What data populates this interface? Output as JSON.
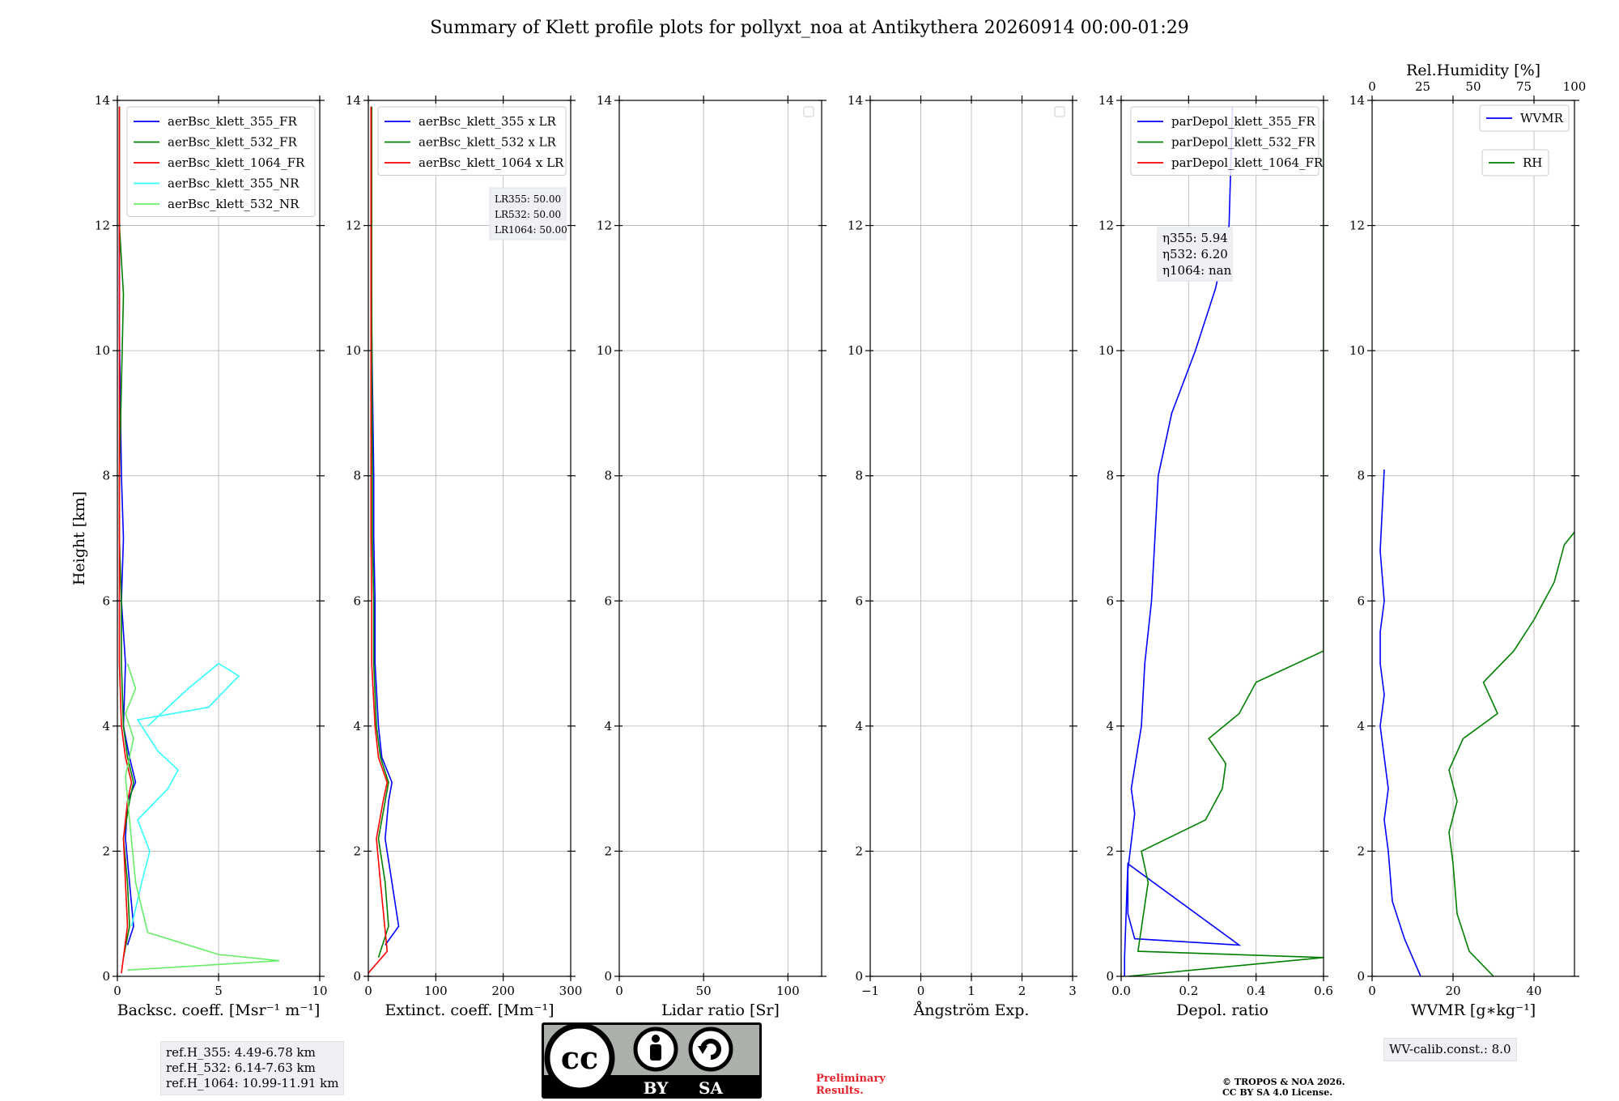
{
  "title": "Summary of Klett profile plots for pollyxt_noa at Antikythera 20260914 00:00-01:29",
  "ylabel": "Height [km]",
  "colors": {
    "blue": "#0000ff",
    "green": "#008000",
    "red": "#ff0000",
    "cyan": "#33ffff",
    "lightgreen": "#66ee66",
    "grid": "#b0b0b0"
  },
  "panels": [
    {
      "id": "bsc",
      "xlabel": "Backsc. coeff. [Msr⁻¹ m⁻¹]",
      "xlim": [
        0,
        10
      ],
      "xticks": [
        "0",
        "5",
        "10"
      ],
      "legend": [
        "aerBsc_klett_355_FR",
        "aerBsc_klett_532_FR",
        "aerBsc_klett_1064_FR",
        "aerBsc_klett_355_NR",
        "aerBsc_klett_532_NR"
      ]
    },
    {
      "id": "ext",
      "xlabel": "Extinct. coeff. [Mm⁻¹]",
      "xlim": [
        0,
        300
      ],
      "xticks": [
        "0",
        "100",
        "200",
        "300"
      ],
      "legend": [
        "aerBsc_klett_355 x LR",
        "aerBsc_klett_532 x LR",
        "aerBsc_klett_1064 x LR"
      ],
      "lr_box": [
        "LR355: 50.00",
        "LR532: 50.00",
        "LR1064: 50.00"
      ]
    },
    {
      "id": "lr",
      "xlabel": "Lidar ratio [Sr]",
      "xlim": [
        0,
        120
      ],
      "xticks": [
        "0",
        "50",
        "100"
      ]
    },
    {
      "id": "ang",
      "xlabel": "Ångström Exp.",
      "xlim": [
        -1,
        3
      ],
      "xticks": [
        "−1",
        "0",
        "1",
        "2",
        "3"
      ]
    },
    {
      "id": "dep",
      "xlabel": "Depol. ratio",
      "xlim": [
        0,
        0.6
      ],
      "xticks": [
        "0.0",
        "0.2",
        "0.4",
        "0.6"
      ],
      "legend": [
        "parDepol_klett_355_FR",
        "parDepol_klett_532_FR",
        "parDepol_klett_1064_FR"
      ],
      "eta_box": [
        "η355: 5.94",
        "η532: 6.20",
        "η1064: nan"
      ]
    },
    {
      "id": "wv",
      "xlabel": "WVMR [g∗kg⁻¹]",
      "xlim": [
        0,
        50
      ],
      "xticks": [
        "0",
        "20",
        "40"
      ],
      "top_label": "Rel.Humidity [%]",
      "top_ticks": [
        "0",
        "25",
        "50",
        "75",
        "100"
      ],
      "legend_wvmr": "WVMR",
      "legend_rh": "RH"
    }
  ],
  "yticks": [
    "0",
    "2",
    "4",
    "6",
    "8",
    "10",
    "12",
    "14"
  ],
  "chart_data": {
    "type": "line",
    "ylim": [
      0,
      14
    ],
    "grid": true,
    "series": [
      {
        "name": "aerBsc_klett_355_FR",
        "panel": "bsc",
        "x": [
          0.5,
          0.8,
          0.6,
          0.4,
          0.5,
          0.9,
          0.6,
          0.3,
          0.4,
          0.2,
          0.3,
          0.2,
          0.1,
          0.1,
          0.1
        ],
        "y": [
          0.5,
          0.8,
          1.5,
          2.2,
          2.8,
          3.1,
          3.5,
          4.0,
          5.0,
          6.0,
          7.0,
          8.0,
          10.3,
          12.0,
          13.9
        ]
      },
      {
        "name": "aerBsc_klett_532_FR",
        "panel": "bsc",
        "x": [
          0.3,
          0.6,
          0.5,
          0.3,
          0.6,
          0.8,
          0.5,
          0.3,
          0.2,
          0.2,
          0.1,
          0.1,
          0.3,
          0.1,
          0.1
        ],
        "y": [
          0.3,
          0.8,
          1.5,
          2.2,
          2.8,
          3.1,
          3.5,
          4.0,
          5.0,
          6.0,
          7.0,
          8.0,
          10.9,
          12.0,
          13.9
        ]
      },
      {
        "name": "aerBsc_klett_1064_FR",
        "panel": "bsc",
        "x": [
          0.2,
          0.5,
          0.4,
          0.3,
          0.5,
          0.7,
          0.4,
          0.2,
          0.1,
          0.1,
          0.1,
          0.1,
          0.1,
          0.1,
          0.1
        ],
        "y": [
          0.05,
          0.8,
          1.5,
          2.2,
          2.8,
          3.1,
          3.5,
          4.0,
          5.0,
          6.0,
          7.0,
          8.0,
          10.0,
          12.0,
          13.9
        ]
      },
      {
        "name": "aerBsc_klett_355_NR",
        "panel": "bsc",
        "x": [
          0.7,
          1.2,
          1.6,
          1.0,
          2.5,
          3.0,
          2.0,
          1.0,
          4.5,
          6.0,
          5.0,
          3.5,
          1.5
        ],
        "y": [
          0.8,
          1.5,
          2.0,
          2.5,
          3.0,
          3.3,
          3.6,
          4.1,
          4.3,
          4.8,
          5.0,
          4.6,
          4.0
        ]
      },
      {
        "name": "aerBsc_klett_532_NR",
        "panel": "bsc",
        "x": [
          0.5,
          8.0,
          5.0,
          1.5,
          0.9,
          0.6,
          0.4,
          0.8,
          0.4,
          0.9,
          0.5
        ],
        "y": [
          0.1,
          0.25,
          0.35,
          0.7,
          1.5,
          2.5,
          3.2,
          3.8,
          4.2,
          4.6,
          5.0
        ]
      },
      {
        "name": "aerBsc_klett_355 x LR",
        "panel": "ext",
        "x": [
          25,
          45,
          35,
          25,
          30,
          35,
          20,
          15,
          10,
          10,
          8,
          8,
          5,
          5,
          5
        ],
        "y": [
          0.5,
          0.8,
          1.5,
          2.2,
          2.8,
          3.1,
          3.5,
          4.0,
          5.0,
          6.0,
          7.0,
          8.0,
          10.3,
          12.0,
          13.9
        ]
      },
      {
        "name": "aerBsc_klett_532 x LR",
        "panel": "ext",
        "x": [
          15,
          30,
          25,
          15,
          25,
          30,
          18,
          12,
          8,
          8,
          6,
          6,
          5,
          5,
          5
        ],
        "y": [
          0.3,
          0.8,
          1.5,
          2.2,
          2.8,
          3.1,
          3.5,
          4.0,
          5.0,
          6.0,
          7.0,
          8.0,
          10.9,
          12.0,
          13.9
        ]
      },
      {
        "name": "aerBsc_klett_1064 x LR",
        "panel": "ext",
        "x": [
          0,
          28,
          18,
          12,
          22,
          28,
          15,
          10,
          5,
          5,
          4,
          4,
          4,
          4,
          4
        ],
        "y": [
          0.05,
          0.4,
          1.5,
          2.2,
          2.8,
          3.1,
          3.5,
          4.0,
          5.0,
          6.0,
          7.0,
          8.0,
          10.0,
          12.0,
          13.9
        ]
      },
      {
        "name": "parDepol_klett_355_FR",
        "panel": "dep",
        "x": [
          0.01,
          0.01,
          0.02,
          0.35,
          0.04,
          0.02,
          0.02,
          0.04,
          0.03,
          0.06,
          0.07,
          0.09,
          0.1,
          0.11,
          0.15,
          0.22,
          0.28,
          0.32,
          0.33
        ],
        "y": [
          0.0,
          0.3,
          1.8,
          0.5,
          0.6,
          1.0,
          1.7,
          2.6,
          3.0,
          4.0,
          5.0,
          6.0,
          7.0,
          8.0,
          9.0,
          10.0,
          11.0,
          12.0,
          13.9
        ]
      },
      {
        "name": "parDepol_klett_532_FR",
        "panel": "dep",
        "x": [
          0.02,
          0.6,
          0.05,
          0.08,
          0.06,
          0.25,
          0.3,
          0.31,
          0.26,
          0.35,
          0.4,
          0.6,
          0.6,
          0.6,
          0.6,
          0.6,
          0.6,
          0.6,
          0.6
        ],
        "y": [
          0.0,
          0.3,
          0.4,
          1.5,
          2.0,
          2.5,
          3.0,
          3.4,
          3.8,
          4.2,
          4.7,
          5.2,
          6.0,
          7.0,
          8.0,
          9.5,
          11.0,
          12.5,
          13.7
        ]
      },
      {
        "name": "parDepol_klett_1064_FR",
        "panel": "dep",
        "x": [],
        "y": []
      },
      {
        "name": "WVMR",
        "panel": "wv",
        "x": [
          12,
          8,
          5,
          4,
          3,
          4,
          3,
          2,
          3,
          2,
          2,
          3,
          2,
          3
        ],
        "y": [
          0.0,
          0.6,
          1.2,
          2.0,
          2.5,
          3.0,
          3.5,
          4.0,
          4.5,
          5.0,
          5.5,
          6.0,
          6.8,
          8.1
        ]
      },
      {
        "name": "RH",
        "panel": "wv",
        "x": [
          60,
          48,
          42,
          40,
          38,
          42,
          38,
          45,
          62,
          55,
          70,
          80,
          90,
          95,
          100
        ],
        "y": [
          0.0,
          0.4,
          1.0,
          1.8,
          2.3,
          2.8,
          3.3,
          3.8,
          4.2,
          4.7,
          5.2,
          5.7,
          6.3,
          6.9,
          7.1
        ]
      }
    ]
  },
  "info_ref": [
    "ref.H_355: 4.49-6.78 km",
    "ref.H_532: 6.14-7.63 km",
    "ref.H_1064: 10.99-11.91 km"
  ],
  "info_wv": "WV-calib.const.: 8.0",
  "cc_badge": {
    "by": "BY",
    "sa": "SA"
  },
  "preliminary": [
    "Preliminary",
    "Results."
  ],
  "copyright": [
    "© TROPOS & NOA 2026.",
    "CC BY SA 4.0 License."
  ]
}
